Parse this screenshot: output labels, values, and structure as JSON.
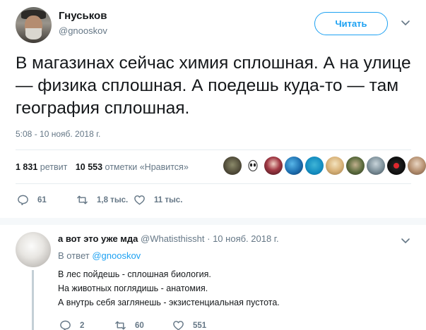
{
  "tweet": {
    "display_name": "Гнуськов",
    "screen_name": "@gnooskov",
    "follow_label": "Читать",
    "text": "В магазинах сейчас химия сплошная. А на улице — физика сплошная. А поедешь куда-то — там география сплошная.",
    "timestamp": "5:08 - 10 нояб. 2018 г.",
    "stats": {
      "retweets_count": "1 831",
      "retweets_label": "ретвит",
      "likes_count": "10 553",
      "likes_label": "отметки «Нравится»"
    },
    "actions": {
      "replies": "61",
      "retweets": "1,8 тыс.",
      "likes": "11 тыс."
    },
    "likers": [
      "liker-avatar",
      "liker-avatar",
      "liker-avatar",
      "liker-avatar",
      "liker-avatar",
      "liker-avatar",
      "liker-avatar",
      "liker-avatar",
      "liker-avatar",
      "liker-avatar"
    ]
  },
  "reply": {
    "display_name": "а вот это уже мда",
    "screen_name": "@Whatisthissht",
    "date": "· 10 нояб. 2018 г.",
    "in_reply_label": "В ответ",
    "in_reply_mention": "@gnooskov",
    "lines": [
      "В лес пойдешь - сплошная биология.",
      "На животных поглядишь - анатомия.",
      "А внутрь себя заглянешь - экзистенциальная пустота."
    ],
    "actions": {
      "replies": "2",
      "retweets": "60",
      "likes": "551"
    }
  },
  "colors": {
    "accent": "#1da1f2",
    "secondary_text": "#657786",
    "primary_text": "#14171a",
    "divider": "#e6ecf0"
  },
  "icons": [
    "chevron-down-icon",
    "reply-icon",
    "retweet-icon",
    "like-icon"
  ]
}
